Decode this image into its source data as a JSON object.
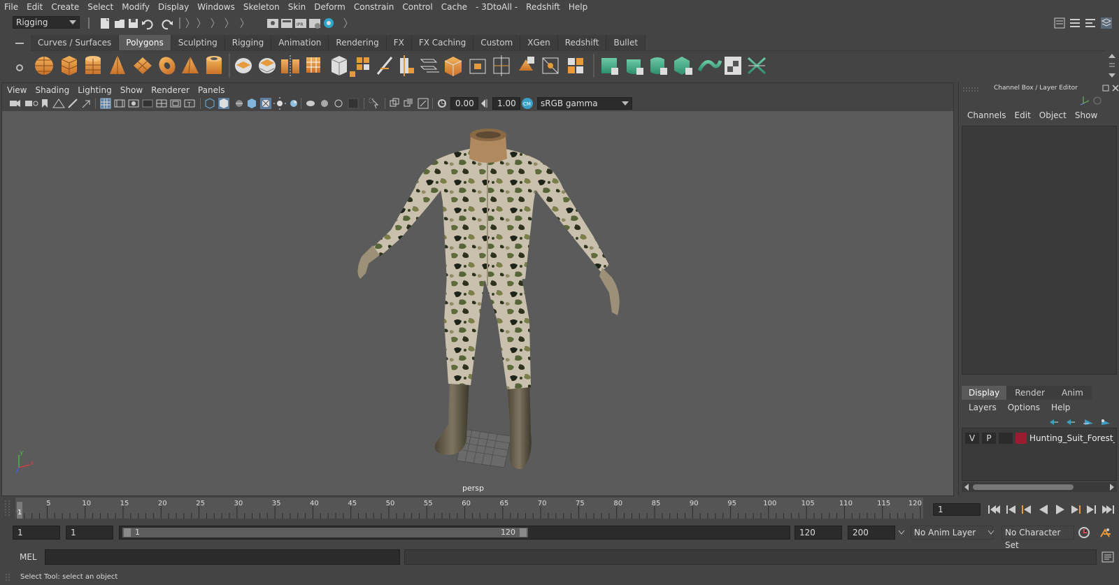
{
  "menubar": [
    "File",
    "Edit",
    "Create",
    "Select",
    "Modify",
    "Display",
    "Windows",
    "Skeleton",
    "Skin",
    "Deform",
    "Constrain",
    "Control",
    "Cache",
    "- 3DtoAll -",
    "Redshift",
    "Help"
  ],
  "statusline": {
    "mode": "Rigging"
  },
  "shelf": {
    "tabs": [
      "Curves / Surfaces",
      "Polygons",
      "Sculpting",
      "Rigging",
      "Animation",
      "Rendering",
      "FX",
      "FX Caching",
      "Custom",
      "XGen",
      "Redshift",
      "Bullet"
    ],
    "active_tab": "Polygons"
  },
  "viewport": {
    "menus": [
      "View",
      "Shading",
      "Lighting",
      "Show",
      "Renderer",
      "Panels"
    ],
    "exposure": "0.00",
    "gamma": "1.00",
    "color_space": "sRGB gamma",
    "camera_label": "persp",
    "axis": {
      "x": "x",
      "y": "y"
    }
  },
  "channelbox": {
    "title": "Channel Box / Layer Editor",
    "menus": [
      "Channels",
      "Edit",
      "Object",
      "Show"
    ],
    "layer_tabs": [
      "Display",
      "Render",
      "Anim"
    ],
    "active_layer_tab": "Display",
    "layer_menus": [
      "Layers",
      "Options",
      "Help"
    ],
    "layer": {
      "v": "V",
      "p": "P",
      "name": "Hunting_Suit_Forest_Camo",
      "color": "#9b1c31"
    }
  },
  "timeline": {
    "ticks": [
      "5",
      "10",
      "15",
      "20",
      "25",
      "30",
      "35",
      "40",
      "45",
      "50",
      "55",
      "60",
      "65",
      "70",
      "75",
      "80",
      "85",
      "90",
      "95",
      "100",
      "105",
      "110",
      "115",
      "120"
    ],
    "start_label": "1",
    "current_frame": "1"
  },
  "range": {
    "start": "1",
    "playback_start": "1",
    "slider_start": "1",
    "slider_end": "120",
    "playback_end": "120",
    "end": "200",
    "anim_layer": "No Anim Layer",
    "character_set": "No Character Set"
  },
  "command": {
    "lang": "MEL"
  },
  "helpline": {
    "text": "Select Tool: select an object"
  },
  "colors": {
    "accent_green": "#4fb28f",
    "shelf_orange": "#e59a3c",
    "active_tab": "#5a5a5a"
  }
}
